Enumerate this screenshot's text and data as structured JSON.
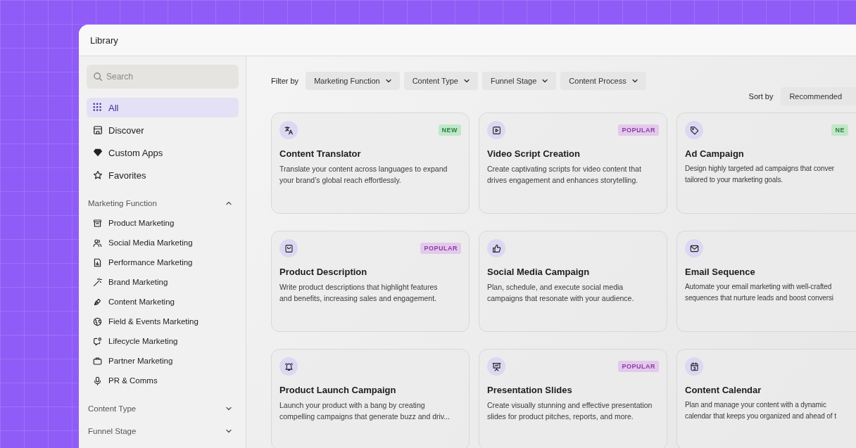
{
  "window": {
    "title": "Library"
  },
  "sidebar": {
    "search": {
      "placeholder": "Search"
    },
    "nav": [
      {
        "label": "All",
        "selected": true
      },
      {
        "label": "Discover",
        "selected": false
      },
      {
        "label": "Custom Apps",
        "selected": false
      },
      {
        "label": "Favorites",
        "selected": false
      }
    ],
    "sections": [
      {
        "title": "Marketing Function",
        "expanded": true,
        "items": [
          "Product Marketing",
          "Social Media Marketing",
          "Performance Marketing",
          "Brand Marketing",
          "Content Marketing",
          "Field & Events Marketing",
          "Lifecycle Marketing",
          "Partner Marketing",
          "PR & Comms"
        ]
      },
      {
        "title": "Content Type",
        "expanded": false
      },
      {
        "title": "Funnel Stage",
        "expanded": false
      }
    ]
  },
  "filters": {
    "label": "Filter by",
    "options": [
      "Marketing Function",
      "Content Type",
      "Funnel Stage",
      "Content Process"
    ]
  },
  "sort": {
    "label": "Sort by",
    "value": "Recommended"
  },
  "cards": [
    {
      "title": "Content Translator",
      "badge": {
        "kind": "new",
        "text": "NEW"
      },
      "lines": [
        "Translate your content across languages to expand",
        "your brand’s global reach effortlessly."
      ]
    },
    {
      "title": "Video Script Creation",
      "badge": {
        "kind": "popular",
        "text": "POPULAR"
      },
      "lines": [
        "Create captivating scripts for video content that",
        "drives engagement and enhances storytelling."
      ]
    },
    {
      "title": "Ad Campaign",
      "badge": {
        "kind": "new",
        "text": "NE"
      },
      "lines": [
        "Design highly targeted ad campaigns that conver",
        "tailored to your marketing goals."
      ]
    },
    {
      "title": "Product Description",
      "badge": {
        "kind": "popular",
        "text": "POPULAR"
      },
      "lines": [
        "Write product descriptions that highlight features",
        "and benefits, increasing sales and engagement."
      ]
    },
    {
      "title": "Social Media Campaign",
      "lines": [
        "Plan, schedule, and execute social media",
        "campaigns that resonate with your audience."
      ]
    },
    {
      "title": "Email Sequence",
      "lines": [
        "Automate your email marketing with well-crafted",
        "sequences that nurture leads and boost conversi"
      ]
    },
    {
      "title": "Product Launch Campaign",
      "lines": [
        "Launch your product with a bang by creating",
        "compelling campaigns that generate buzz and driv..."
      ]
    },
    {
      "title": "Presentation Slides",
      "badge": {
        "kind": "popular",
        "text": "POPULAR"
      },
      "lines": [
        "Create visually stunning and effective presentation",
        "slides for product pitches, reports, and more."
      ]
    },
    {
      "title": "Content Calendar",
      "lines": [
        "Plan and manage your content with a dynamic",
        "calendar that keeps you organized and ahead of t"
      ]
    }
  ]
}
